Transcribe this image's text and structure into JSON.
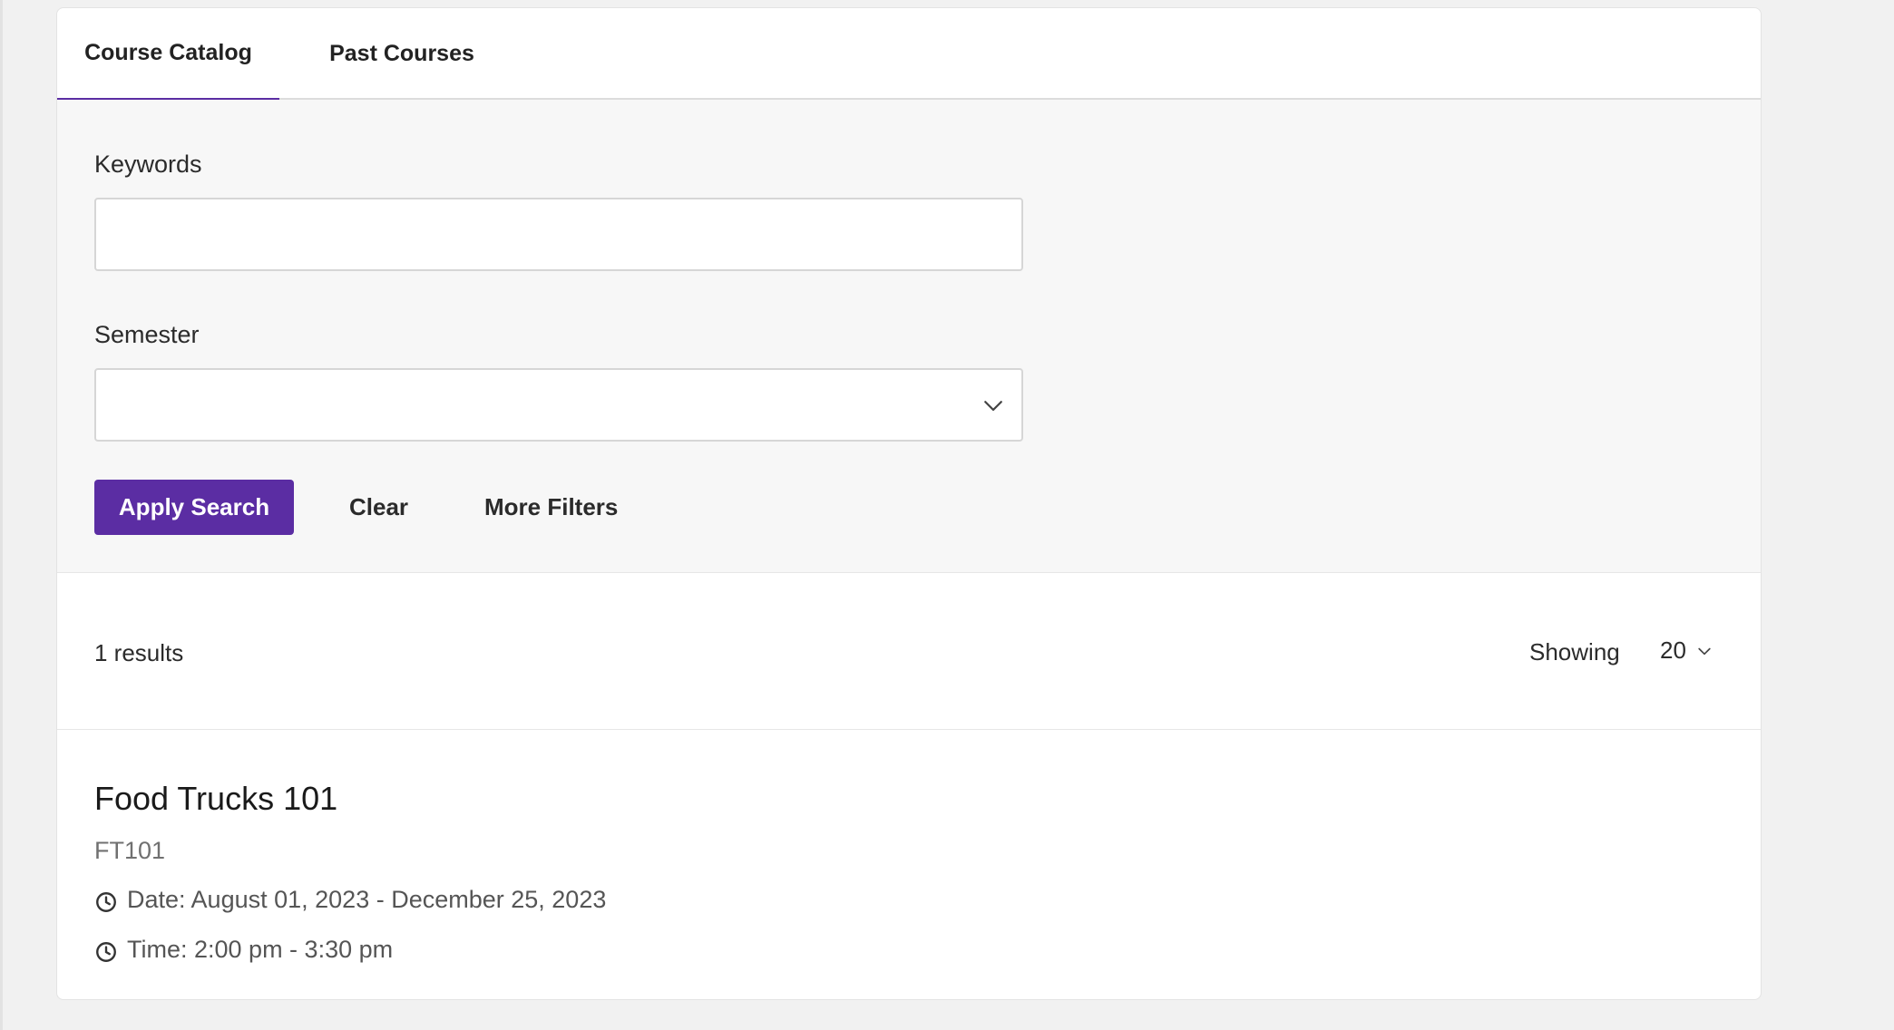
{
  "tabs": [
    {
      "label": "Course Catalog",
      "active": true
    },
    {
      "label": "Past Courses",
      "active": false
    }
  ],
  "search": {
    "keywords_label": "Keywords",
    "keywords_value": "",
    "keywords_placeholder": "",
    "semester_label": "Semester",
    "semester_value": "",
    "apply_label": "Apply Search",
    "clear_label": "Clear",
    "more_filters_label": "More Filters"
  },
  "results": {
    "count_text": "1 results",
    "showing_label": "Showing",
    "page_size": "20"
  },
  "courses": [
    {
      "title": "Food Trucks 101",
      "code": "FT101",
      "date": "Date: August 01, 2023 - December 25, 2023",
      "time": "Time: 2:00 pm - 3:30 pm"
    }
  ],
  "icons": {
    "semester_chevron": "chevron-down-icon",
    "page_size_chevron": "chevron-down-icon",
    "date_icon": "clock-icon",
    "time_icon": "clock-icon"
  },
  "colors": {
    "accent": "#5b2da3",
    "panel_bg": "#f7f7f7",
    "page_bg": "#f1f1f1"
  }
}
